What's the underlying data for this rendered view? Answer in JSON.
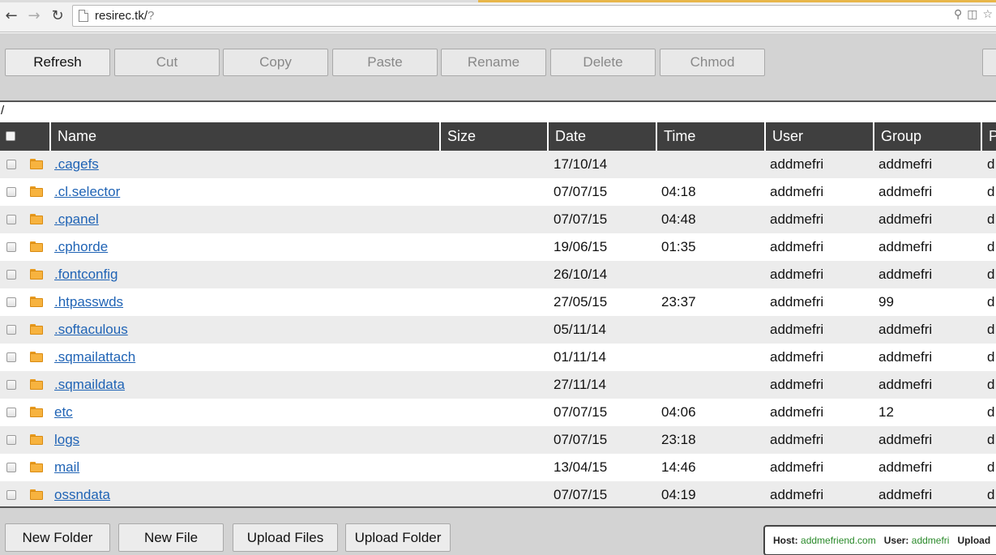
{
  "browser": {
    "url_host": "resirec.tk/",
    "url_query": "?"
  },
  "toolbar": {
    "buttons": [
      {
        "label": "Refresh",
        "enabled": true
      },
      {
        "label": "Cut",
        "enabled": false
      },
      {
        "label": "Copy",
        "enabled": false
      },
      {
        "label": "Paste",
        "enabled": false
      },
      {
        "label": "Rename",
        "enabled": false
      },
      {
        "label": "Delete",
        "enabled": false
      },
      {
        "label": "Chmod",
        "enabled": false
      }
    ]
  },
  "path": "/",
  "table": {
    "columns": {
      "name": "Name",
      "size": "Size",
      "date": "Date",
      "time": "Time",
      "user": "User",
      "group": "Group",
      "perms": "P"
    },
    "rows": [
      {
        "name": ".cagefs",
        "size": "",
        "date": "17/10/14",
        "time": "",
        "user": "addmefri",
        "group": "addmefri",
        "perms": "d"
      },
      {
        "name": ".cl.selector",
        "size": "",
        "date": "07/07/15",
        "time": "04:18",
        "user": "addmefri",
        "group": "addmefri",
        "perms": "d"
      },
      {
        "name": ".cpanel",
        "size": "",
        "date": "07/07/15",
        "time": "04:48",
        "user": "addmefri",
        "group": "addmefri",
        "perms": "d"
      },
      {
        "name": ".cphorde",
        "size": "",
        "date": "19/06/15",
        "time": "01:35",
        "user": "addmefri",
        "group": "addmefri",
        "perms": "d"
      },
      {
        "name": ".fontconfig",
        "size": "",
        "date": "26/10/14",
        "time": "",
        "user": "addmefri",
        "group": "addmefri",
        "perms": "d"
      },
      {
        "name": ".htpasswds",
        "size": "",
        "date": "27/05/15",
        "time": "23:37",
        "user": "addmefri",
        "group": "99",
        "perms": "d"
      },
      {
        "name": ".softaculous",
        "size": "",
        "date": "05/11/14",
        "time": "",
        "user": "addmefri",
        "group": "addmefri",
        "perms": "d"
      },
      {
        "name": ".sqmailattach",
        "size": "",
        "date": "01/11/14",
        "time": "",
        "user": "addmefri",
        "group": "addmefri",
        "perms": "d"
      },
      {
        "name": ".sqmaildata",
        "size": "",
        "date": "27/11/14",
        "time": "",
        "user": "addmefri",
        "group": "addmefri",
        "perms": "d"
      },
      {
        "name": "etc",
        "size": "",
        "date": "07/07/15",
        "time": "04:06",
        "user": "addmefri",
        "group": "12",
        "perms": "d"
      },
      {
        "name": "logs",
        "size": "",
        "date": "07/07/15",
        "time": "23:18",
        "user": "addmefri",
        "group": "addmefri",
        "perms": "d"
      },
      {
        "name": "mail",
        "size": "",
        "date": "13/04/15",
        "time": "14:46",
        "user": "addmefri",
        "group": "addmefri",
        "perms": "d"
      },
      {
        "name": "ossndata",
        "size": "",
        "date": "07/07/15",
        "time": "04:19",
        "user": "addmefri",
        "group": "addmefri",
        "perms": "d"
      }
    ]
  },
  "bottombar": {
    "buttons": [
      "New Folder",
      "New File",
      "Upload Files",
      "Upload Folder"
    ],
    "status": {
      "host_label": "Host:",
      "host_value": "addmefriend.com",
      "user_label": "User:",
      "user_value": "addmefri",
      "upload_label": "Upload"
    }
  }
}
